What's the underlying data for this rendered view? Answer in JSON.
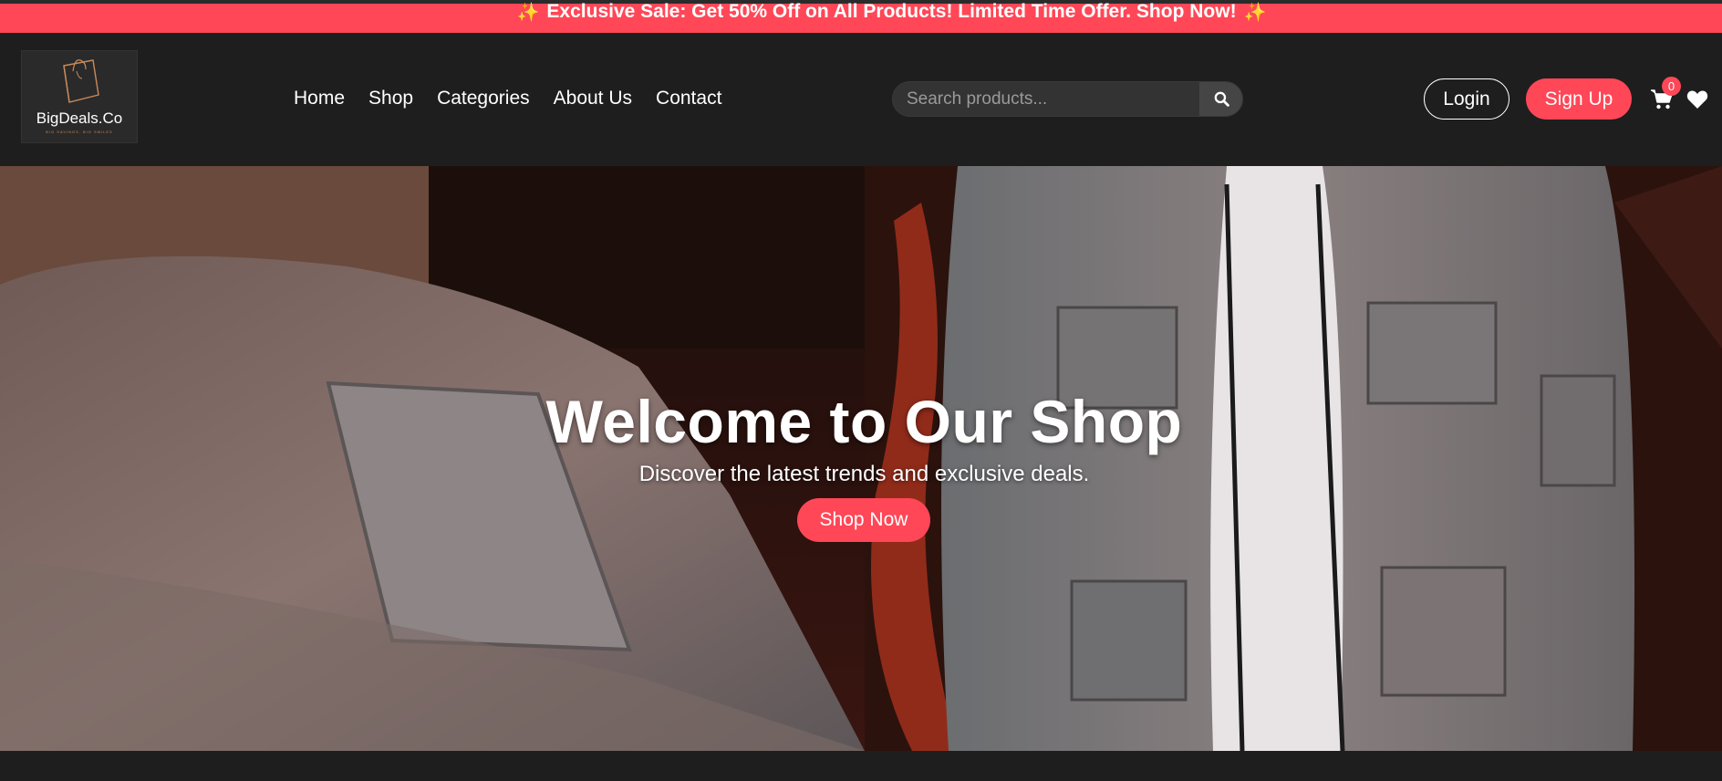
{
  "promo": {
    "text": "Exclusive Sale: Get 50% Off on All Products! Limited Time Offer. Shop Now!",
    "icon": "sparkles-icon"
  },
  "brand": {
    "name": "BigDeals.Co",
    "tagline": "BIG SAVINGS, BIG SMILES"
  },
  "nav": {
    "items": [
      "Home",
      "Shop",
      "Categories",
      "About Us",
      "Contact"
    ]
  },
  "search": {
    "placeholder": "Search products...",
    "icon": "search-icon"
  },
  "auth": {
    "login": "Login",
    "signup": "Sign Up"
  },
  "cart": {
    "count": "0",
    "icon": "cart-icon"
  },
  "wishlist": {
    "icon": "heart-icon"
  },
  "hero": {
    "title": "Welcome to Our Shop",
    "subtitle": "Discover the latest trends and exclusive deals.",
    "cta": "Shop Now"
  },
  "colors": {
    "accent": "#ff4757",
    "header_bg": "#1e1e1e",
    "search_bg": "#333333"
  }
}
